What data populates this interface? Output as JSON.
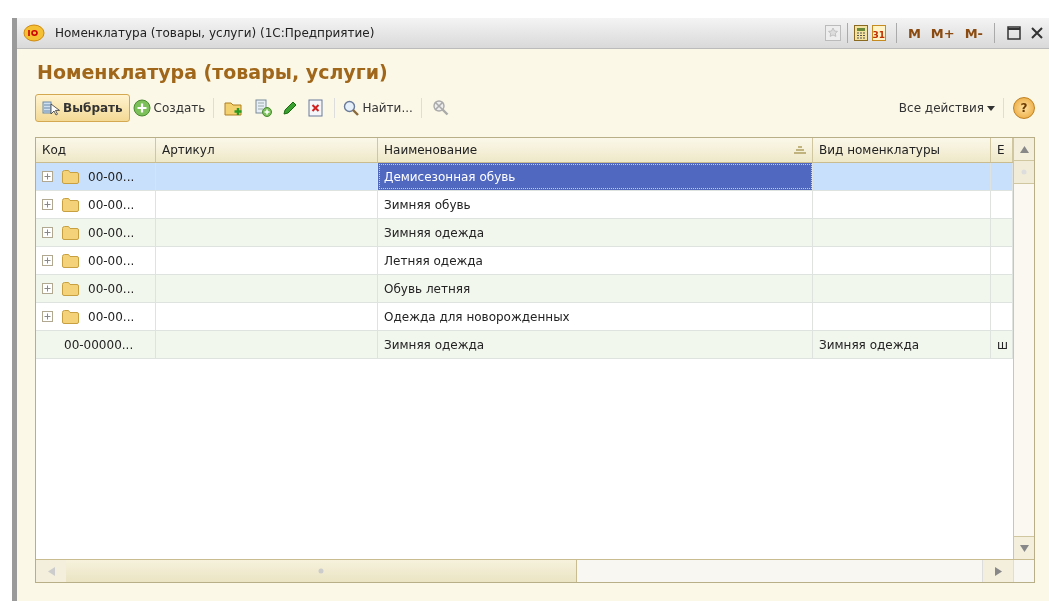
{
  "window": {
    "title": "Номенклатура (товары, услуги)  (1С:Предприятие)",
    "calendar_day": "31",
    "memory_buttons": [
      "M",
      "M+",
      "M-"
    ]
  },
  "form": {
    "heading": "Номенклатура (товары, услуги)"
  },
  "toolbar": {
    "choose": "Выбрать",
    "create": "Создать",
    "find": "Найти...",
    "all_actions": "Все действия",
    "help": "?"
  },
  "table": {
    "columns": [
      {
        "label": "Код",
        "sorted": false
      },
      {
        "label": "Артикул",
        "sorted": false
      },
      {
        "label": "Наименование",
        "sorted": true
      },
      {
        "label": "Вид номенклатуры",
        "sorted": false
      },
      {
        "label": "Е",
        "sorted": false
      }
    ],
    "rows": [
      {
        "kind": "group",
        "selected": true,
        "cells": [
          "00-00...",
          "",
          "Демисезонная обувь",
          "",
          ""
        ]
      },
      {
        "kind": "group",
        "selected": false,
        "cells": [
          "00-00...",
          "",
          "Зимняя обувь",
          "",
          ""
        ]
      },
      {
        "kind": "group",
        "selected": false,
        "cells": [
          "00-00...",
          "",
          "Зимняя одежда",
          "",
          ""
        ]
      },
      {
        "kind": "group",
        "selected": false,
        "cells": [
          "00-00...",
          "",
          "Летняя одежда",
          "",
          ""
        ]
      },
      {
        "kind": "group",
        "selected": false,
        "cells": [
          "00-00...",
          "",
          "Обувь летняя",
          "",
          ""
        ]
      },
      {
        "kind": "group",
        "selected": false,
        "cells": [
          "00-00...",
          "",
          "Одежда для новорожденных",
          "",
          ""
        ]
      },
      {
        "kind": "item",
        "selected": false,
        "cells": [
          "00-00000...",
          "",
          "Зимняя одежда",
          "Зимняя одежда",
          "ш"
        ]
      }
    ]
  }
}
